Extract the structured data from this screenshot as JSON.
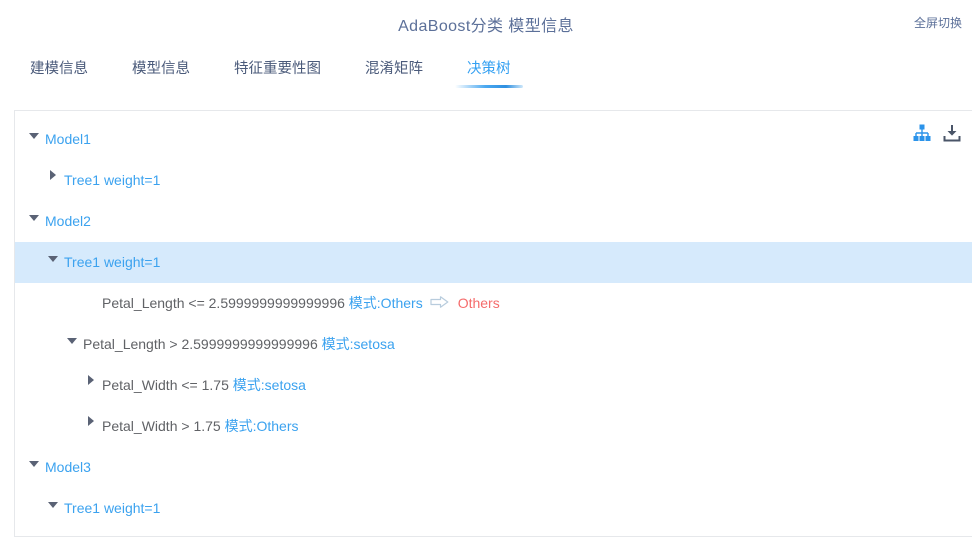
{
  "header": {
    "title": "AdaBoost分类 模型信息",
    "fullscreen_label": "全屏切换"
  },
  "tabs": [
    {
      "label": "建模信息",
      "active": false
    },
    {
      "label": "模型信息",
      "active": false
    },
    {
      "label": "特征重要性图",
      "active": false
    },
    {
      "label": "混淆矩阵",
      "active": false
    },
    {
      "label": "决策树",
      "active": true
    }
  ],
  "panel": {
    "actions": [
      {
        "name": "sitemap-icon",
        "title": "树状图"
      },
      {
        "name": "download-icon",
        "title": "下载"
      }
    ],
    "colors": {
      "accent": "#3ba2ef",
      "selected_row_bg": "#d6eafc",
      "node_text": "#606266",
      "result_red": "#f56c6c",
      "title_text": "#5c7099",
      "border": "#e6e8eb"
    }
  },
  "tree": {
    "rows": [
      {
        "indent": 0,
        "caret": "down",
        "selected": false,
        "segments": [
          {
            "text": "Model1",
            "style": "blue"
          }
        ]
      },
      {
        "indent": 1,
        "caret": "right",
        "selected": false,
        "segments": [
          {
            "text": "Tree1 weight=1",
            "style": "blue"
          }
        ]
      },
      {
        "indent": 0,
        "caret": "down",
        "selected": false,
        "segments": [
          {
            "text": "Model2",
            "style": "blue"
          }
        ]
      },
      {
        "indent": 1,
        "caret": "down",
        "selected": true,
        "segments": [
          {
            "text": "Tree1 weight=1",
            "style": "blue"
          }
        ]
      },
      {
        "indent": 3,
        "caret": "none",
        "selected": false,
        "segments": [
          {
            "text": "Petal_Length <= 2.5999999999999996 ",
            "style": "gray"
          },
          {
            "text": "模式:Others",
            "style": "mode"
          },
          {
            "text": "⇨",
            "style": "arrow"
          },
          {
            "text": "Others",
            "style": "red"
          }
        ]
      },
      {
        "indent": 2,
        "caret": "down",
        "selected": false,
        "segments": [
          {
            "text": "Petal_Length > 2.5999999999999996 ",
            "style": "gray"
          },
          {
            "text": "模式:setosa",
            "style": "mode"
          }
        ]
      },
      {
        "indent": 3,
        "caret": "right",
        "selected": false,
        "segments": [
          {
            "text": "Petal_Width <= 1.75 ",
            "style": "gray"
          },
          {
            "text": "模式:setosa",
            "style": "mode"
          }
        ]
      },
      {
        "indent": 3,
        "caret": "right",
        "selected": false,
        "segments": [
          {
            "text": "Petal_Width > 1.75 ",
            "style": "gray"
          },
          {
            "text": "模式:Others",
            "style": "mode"
          }
        ]
      },
      {
        "indent": 0,
        "caret": "down",
        "selected": false,
        "segments": [
          {
            "text": "Model3",
            "style": "blue"
          }
        ]
      },
      {
        "indent": 1,
        "caret": "down",
        "selected": false,
        "segments": [
          {
            "text": "Tree1 weight=1",
            "style": "blue"
          }
        ]
      }
    ]
  }
}
